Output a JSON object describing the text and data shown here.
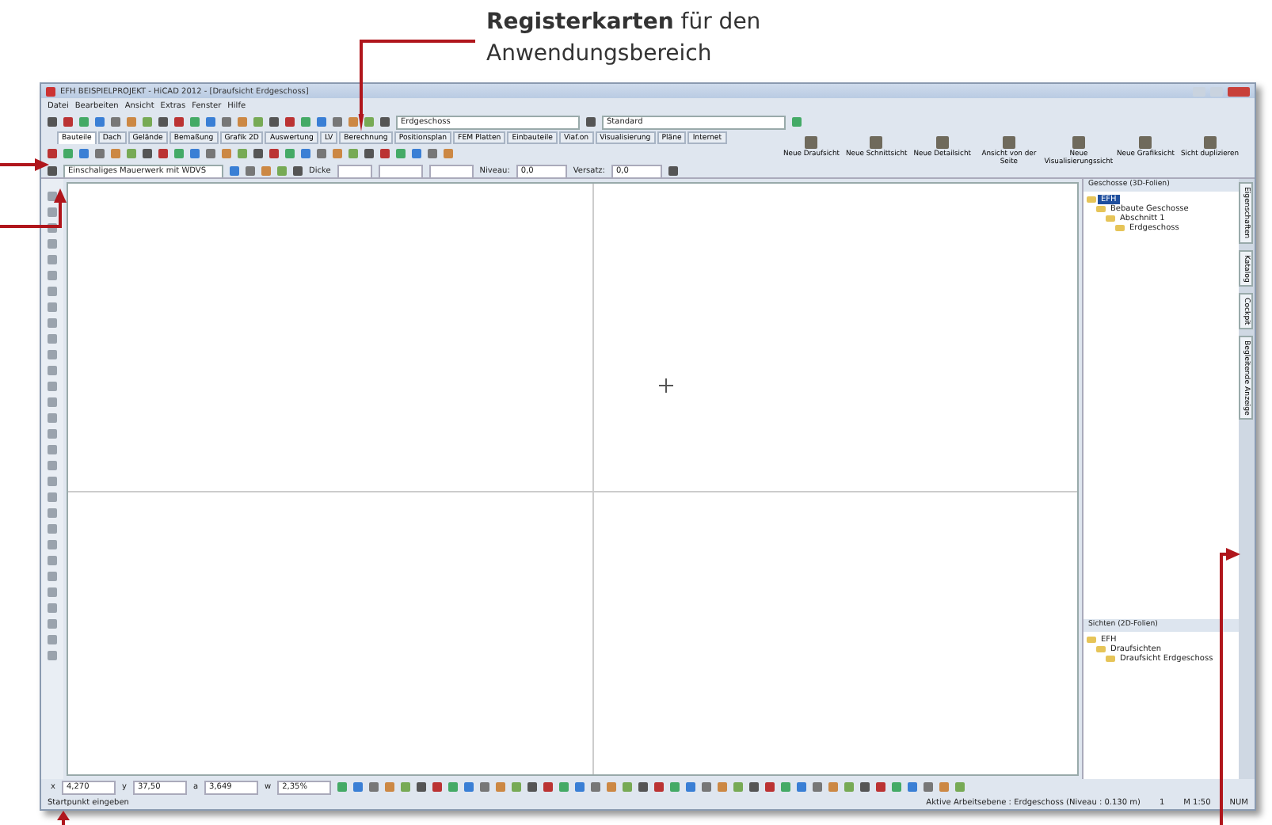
{
  "callout": {
    "text": "**Registerkarten** für den Anwendungsbereich"
  },
  "window": {
    "title": "EFH BEISPIELPROJEKT - HiCAD 2012 - [Draufsicht Erdgeschoss]"
  },
  "menu": [
    "Datei",
    "Bearbeiten",
    "Ansicht",
    "Extras",
    "Fenster",
    "Hilfe"
  ],
  "toolbar": {
    "floor_select": "Erdgeschoss",
    "style_select": "Standard"
  },
  "tabs": [
    {
      "label": "Bauteile",
      "selected": true
    },
    {
      "label": "Dach",
      "selected": false
    },
    {
      "label": "Gelände",
      "selected": false
    },
    {
      "label": "Bemaßung",
      "selected": false
    },
    {
      "label": "Grafik 2D",
      "selected": false
    },
    {
      "label": "Auswertung",
      "selected": false
    },
    {
      "label": "LV",
      "selected": false
    },
    {
      "label": "Berechnung",
      "selected": false
    },
    {
      "label": "Positionsplan",
      "selected": false
    },
    {
      "label": "FEM Platten",
      "selected": false
    },
    {
      "label": "Einbauteile",
      "selected": false
    },
    {
      "label": "Viaf.on",
      "selected": false
    },
    {
      "label": "Visualisierung",
      "selected": false
    },
    {
      "label": "Pläne",
      "selected": false
    },
    {
      "label": "Internet",
      "selected": false
    }
  ],
  "view_buttons": [
    "Neue Draufsicht",
    "Neue Schnittsicht",
    "Neue Detailsicht",
    "Ansicht von der Seite",
    "Neue Visualisierungssicht",
    "Neue Grafiksicht",
    "Sicht duplizieren"
  ],
  "property_bar": {
    "component": "Einschaliges Mauerwerk mit WDVS",
    "thickness_label": "Dicke",
    "level_label": "Niveau:",
    "level_value": "0,0",
    "offset_label": "Versatz:",
    "offset_value": "0,0"
  },
  "storeys_panel": {
    "title": "Geschosse (3D-Folien)",
    "tree": [
      {
        "label": "EFH",
        "selected": true,
        "children": [
          {
            "label": "Bebaute Geschosse",
            "selected": false,
            "children": [
              {
                "label": "Abschnitt 1",
                "selected": false,
                "children": [
                  {
                    "label": "Erdgeschoss",
                    "selected": false
                  }
                ]
              }
            ]
          }
        ]
      }
    ]
  },
  "views_panel": {
    "title": "Sichten (2D-Folien)",
    "tree": [
      {
        "label": "EFH",
        "selected": false,
        "children": [
          {
            "label": "Draufsichten",
            "selected": false,
            "children": [
              {
                "label": "Draufsicht Erdgeschoss",
                "selected": false
              }
            ]
          }
        ]
      }
    ]
  },
  "side_tabs": [
    "Eigenschaften",
    "Katalog",
    "Cockpit",
    "Begleitende Anzeige"
  ],
  "coordinates": [
    {
      "label": "x",
      "value": "4,270"
    },
    {
      "label": "y",
      "value": "37,50"
    },
    {
      "label": "a",
      "value": "3,649"
    },
    {
      "label": "w",
      "value": "2,35%"
    }
  ],
  "status_bar": {
    "prompt": "Startpunkt eingeben",
    "working_plane": "Aktive Arbeitsebene : Erdgeschoss (Niveau : 0.130 m)",
    "number": "1",
    "scale": "M 1:50",
    "num": "NUM"
  }
}
